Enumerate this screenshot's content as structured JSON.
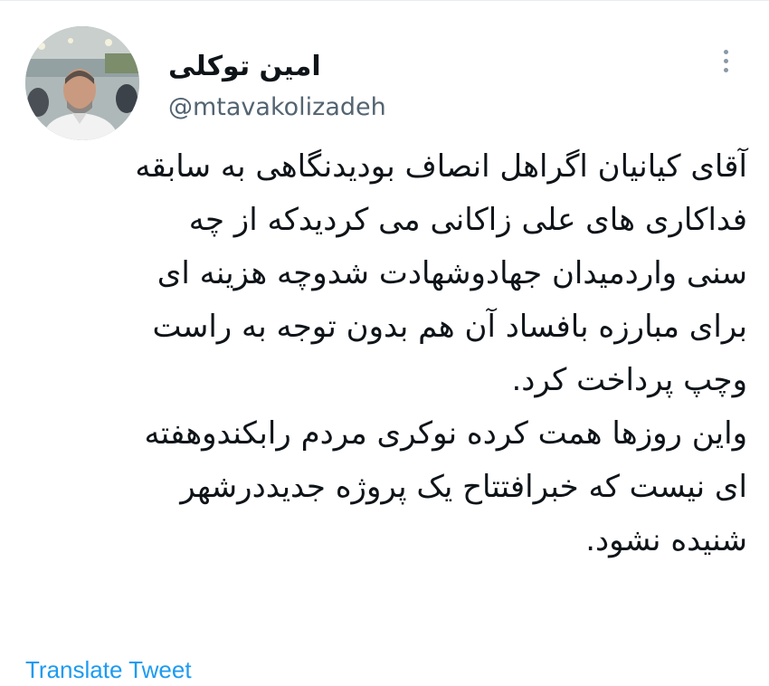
{
  "author": {
    "display_name": "امین توکلی",
    "handle": "@mtavakolizadeh",
    "avatar_icon": "profile-photo"
  },
  "tweet": {
    "lines": [
      "آقای کیانیان اگراهل انصاف بودیدنگاهی به سابقه",
      "فداکاری های علی زاکانی می کردیدکه از چه",
      "سنی واردمیدان جهادوشهادت شدوچه هزینه ای",
      "برای مبارزه بافساد آن هم بدون توجه به راست",
      "وچپ پرداخت کرد.",
      "واین روزها همت کرده نوکری مردم رابکندوهفته",
      "ای نیست که خبرافتتاح یک پروژه جدیددرشهر",
      "شنیده نشود."
    ]
  },
  "actions": {
    "more_icon": "more-options-icon",
    "translate_label": "Translate Tweet"
  },
  "colors": {
    "text": "#0f1419",
    "secondary": "#536471",
    "link": "#1d9bf0"
  }
}
